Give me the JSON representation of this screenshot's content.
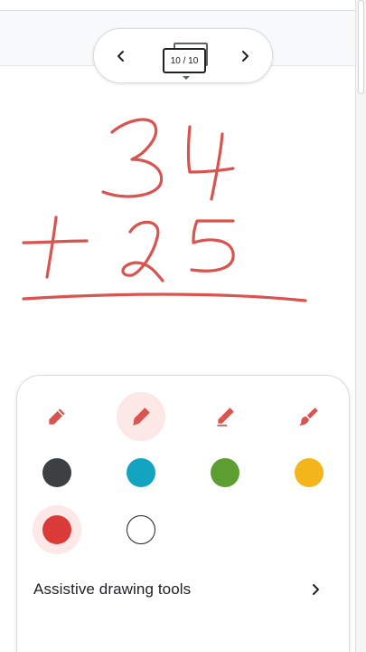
{
  "pager": {
    "current_label": "10 / 10",
    "prev_icon": "chevron-left-icon",
    "next_icon": "chevron-right-icon"
  },
  "canvas": {
    "ink_color": "#d9534f",
    "drawing": "handwritten-addition"
  },
  "toolbar": {
    "tools": [
      {
        "icon": "pen-icon",
        "selected": false
      },
      {
        "icon": "marker-icon",
        "selected": true
      },
      {
        "icon": "highlighter-icon",
        "selected": false
      },
      {
        "icon": "brush-icon",
        "selected": false
      }
    ],
    "colors": [
      {
        "name": "black",
        "hex": "#3c4043",
        "selected": false
      },
      {
        "name": "cyan",
        "hex": "#12a4c1",
        "selected": false
      },
      {
        "name": "green",
        "hex": "#5c9e31",
        "selected": false
      },
      {
        "name": "yellow",
        "hex": "#f3b51b",
        "selected": false
      },
      {
        "name": "red",
        "hex": "#db3b38",
        "selected": true
      },
      {
        "name": "white",
        "hex": "#ffffff",
        "selected": false
      }
    ],
    "assistive_label": "Assistive drawing tools",
    "assistive_icon": "chevron-right-icon",
    "close_icon": "close-icon"
  }
}
